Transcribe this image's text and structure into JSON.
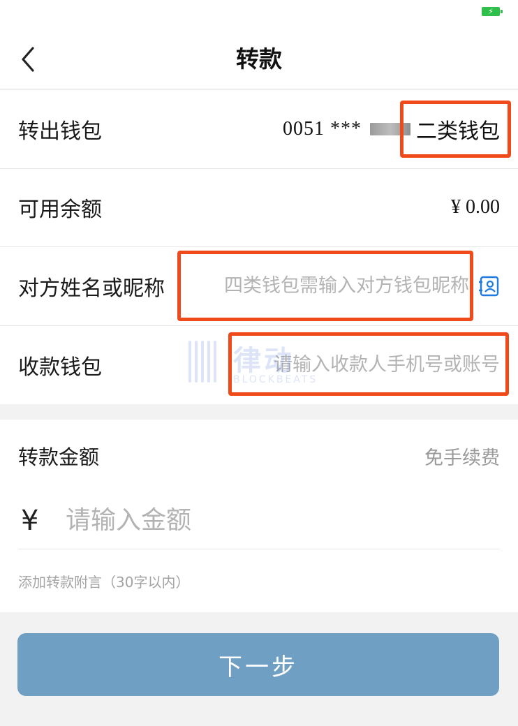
{
  "nav": {
    "title": "转款"
  },
  "rows": {
    "from_wallet": {
      "label": "转出钱包",
      "number": "0051 ***",
      "type": "二类钱包"
    },
    "balance": {
      "label": "可用余额",
      "value": "¥ 0.00"
    },
    "nickname": {
      "label": "对方姓名或昵称",
      "placeholder": "四类钱包需输入对方钱包昵称"
    },
    "receive_wallet": {
      "label": "收款钱包",
      "placeholder": "请输入收款人手机号或账号"
    }
  },
  "amount": {
    "label": "转款金额",
    "fee_note": "免手续费",
    "currency": "¥",
    "placeholder": "请输入金额",
    "remark": "添加转款附言（30字以内）"
  },
  "next_button": "下一步",
  "watermark": {
    "brand": "律动",
    "sub": "BLOCKBEATS"
  },
  "colors": {
    "accent_button": "#709fc4",
    "highlight_border": "#f04a1a",
    "battery": "#2fbf4a",
    "contact_icon": "#1f7ae0"
  },
  "icons": {
    "back": "chevron-left-icon",
    "contacts": "contact-card-icon",
    "battery": "battery-charging-icon"
  }
}
